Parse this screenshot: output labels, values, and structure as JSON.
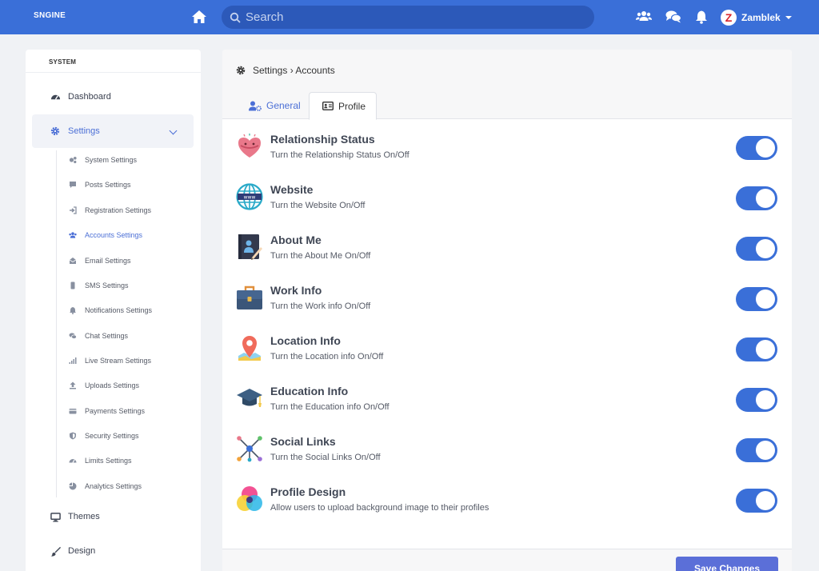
{
  "header": {
    "brand": "SNGINE",
    "search_placeholder": "Search",
    "user_initial": "Z",
    "user_name": "Zamblek"
  },
  "sidebar": {
    "title": "SYSTEM",
    "items": [
      {
        "label": "Dashboard",
        "icon": "dashboard-icon"
      },
      {
        "label": "Settings",
        "icon": "gear-icon"
      },
      {
        "label": "Themes",
        "icon": "desktop-icon"
      },
      {
        "label": "Design",
        "icon": "paintbrush-icon"
      }
    ],
    "sub_items": [
      {
        "label": "System Settings",
        "icon": "cogs-icon"
      },
      {
        "label": "Posts Settings",
        "icon": "comment-icon"
      },
      {
        "label": "Registration Settings",
        "icon": "sign-in-icon"
      },
      {
        "label": "Accounts Settings",
        "icon": "users-icon"
      },
      {
        "label": "Email Settings",
        "icon": "envelope-icon"
      },
      {
        "label": "SMS Settings",
        "icon": "mobile-icon"
      },
      {
        "label": "Notifications Settings",
        "icon": "bell-icon"
      },
      {
        "label": "Chat Settings",
        "icon": "comments-icon"
      },
      {
        "label": "Live Stream Settings",
        "icon": "signal-icon"
      },
      {
        "label": "Uploads Settings",
        "icon": "upload-icon"
      },
      {
        "label": "Payments Settings",
        "icon": "credit-card-icon"
      },
      {
        "label": "Security Settings",
        "icon": "shield-icon"
      },
      {
        "label": "Limits Settings",
        "icon": "gauge-icon"
      },
      {
        "label": "Analytics Settings",
        "icon": "pie-chart-icon"
      }
    ]
  },
  "main": {
    "breadcrumb": "Settings › Accounts",
    "tabs": [
      {
        "label": "General",
        "icon": "user-cog-icon"
      },
      {
        "label": "Profile",
        "icon": "id-card-icon"
      }
    ],
    "rows": [
      {
        "title": "Relationship Status",
        "desc": "Turn the Relationship Status On/Off",
        "icon": "heart-icon",
        "enabled": true
      },
      {
        "title": "Website",
        "desc": "Turn the Website On/Off",
        "icon": "globe-icon",
        "enabled": true
      },
      {
        "title": "About Me",
        "desc": "Turn the About Me On/Off",
        "icon": "notebook-icon",
        "enabled": true
      },
      {
        "title": "Work Info",
        "desc": "Turn the Work info On/Off",
        "icon": "briefcase-icon",
        "enabled": true
      },
      {
        "title": "Location Info",
        "desc": "Turn the Location info On/Off",
        "icon": "map-pin-icon",
        "enabled": true
      },
      {
        "title": "Education Info",
        "desc": "Turn the Education info On/Off",
        "icon": "graduation-cap-icon",
        "enabled": true
      },
      {
        "title": "Social Links",
        "desc": "Turn the Social Links On/Off",
        "icon": "network-icon",
        "enabled": true
      },
      {
        "title": "Profile Design",
        "desc": "Allow users to upload background image to their profiles",
        "icon": "color-circles-icon",
        "enabled": true
      }
    ],
    "save_label": "Save Changes"
  },
  "colors": {
    "accent": "#3a6fd8",
    "header_bg": "#3a6fd8",
    "search_bg": "#2c59b9"
  }
}
